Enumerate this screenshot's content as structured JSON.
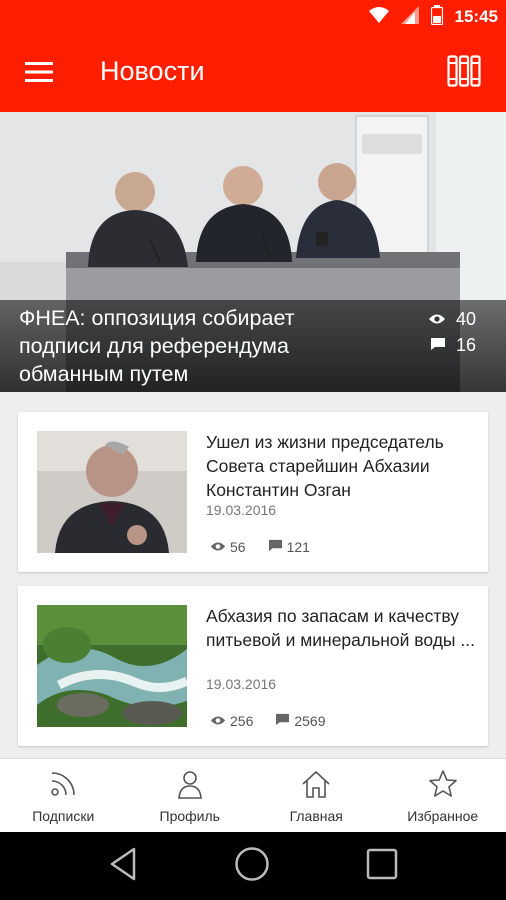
{
  "status_bar": {
    "time": "15:45"
  },
  "app_bar": {
    "title": "Новости"
  },
  "hero": {
    "title": "ФНЕА: оппозиция собирает подписи для референдума обманным путем",
    "views": "40",
    "comments": "16"
  },
  "articles": [
    {
      "title": "Ушел из жизни председатель Совета старейшин Абхазии Константин Озган",
      "date": "19.03.2016",
      "views": "56",
      "comments": "121"
    },
    {
      "title": "Абхазия по запасам и качеству питьевой и минеральной воды ...",
      "date": "19.03.2016",
      "views": "256",
      "comments": "2569"
    }
  ],
  "bottom_nav": {
    "items": [
      {
        "label": "Подписки",
        "icon": "rss-icon"
      },
      {
        "label": "Профиль",
        "icon": "person-icon"
      },
      {
        "label": "Главная",
        "icon": "home-icon"
      },
      {
        "label": "Избранное",
        "icon": "star-icon"
      }
    ]
  },
  "colors": {
    "accent": "#ff1f00",
    "background": "#eeeeee"
  }
}
